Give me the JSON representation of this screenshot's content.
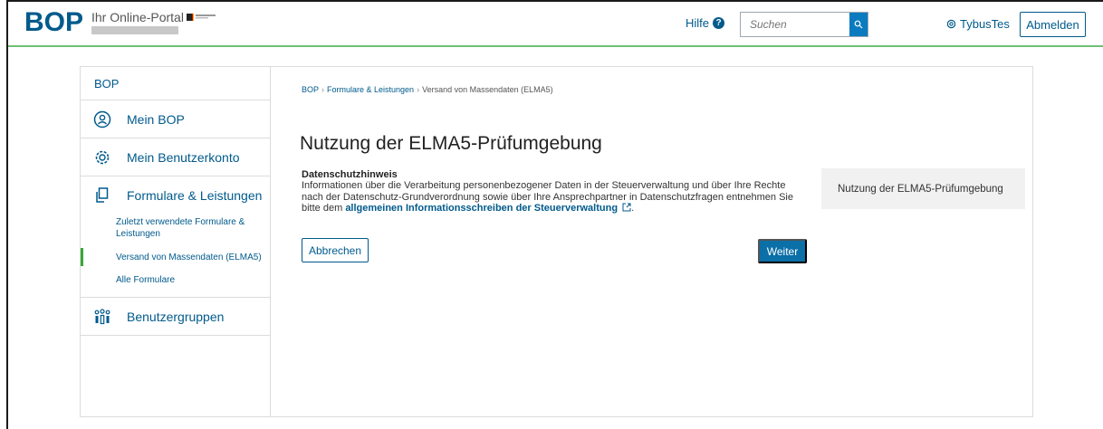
{
  "header": {
    "logo": "BOP",
    "portal_text": "Ihr Online-Portal",
    "help_label": "Hilfe",
    "search": {
      "placeholder": "Suchen"
    },
    "user_name": "TybusTes",
    "logout_label": "Abmelden",
    "colors": {
      "brand": "#005a8c",
      "accent_line": "#6fbf73",
      "search_button": "#0b7bbf"
    }
  },
  "sidebar": {
    "top_label": "BOP",
    "items": [
      {
        "label": "Mein BOP",
        "icon": "person-circle-icon"
      },
      {
        "label": "Mein Benutzerkonto",
        "icon": "gear-icon"
      },
      {
        "label": "Formulare & Leistungen",
        "icon": "documents-icon"
      },
      {
        "label": "Benutzergruppen",
        "icon": "users-group-icon"
      }
    ],
    "subitems": [
      {
        "label": "Zuletzt verwendete Formulare & Leistungen",
        "active": false
      },
      {
        "label": "Versand von Massendaten (ELMA5)",
        "active": true
      },
      {
        "label": "Alle Formulare",
        "active": false
      }
    ]
  },
  "main": {
    "breadcrumb": [
      "BOP",
      "Formulare & Leistungen",
      "Versand von Massendaten (ELMA5)"
    ],
    "title": "Nutzung der ELMA5-Prüfumgebung",
    "privacy": {
      "heading": "Datenschutzhinweis",
      "text": "Informationen über die Verarbeitung personenbezogener Daten in der Steuerverwaltung und über Ihre Rechte nach der Datenschutz-Grundverordnung sowie über Ihre Ansprechpartner in Datenschutzfragen entnehmen Sie bitte dem",
      "link": "allgemeinen Informationsschreiben der Steuerverwaltung",
      "suffix": "."
    },
    "side_box": "Nutzung der ELMA5-Prüfumgebung",
    "cancel_label": "Abbrechen",
    "next_label": "Weiter"
  }
}
